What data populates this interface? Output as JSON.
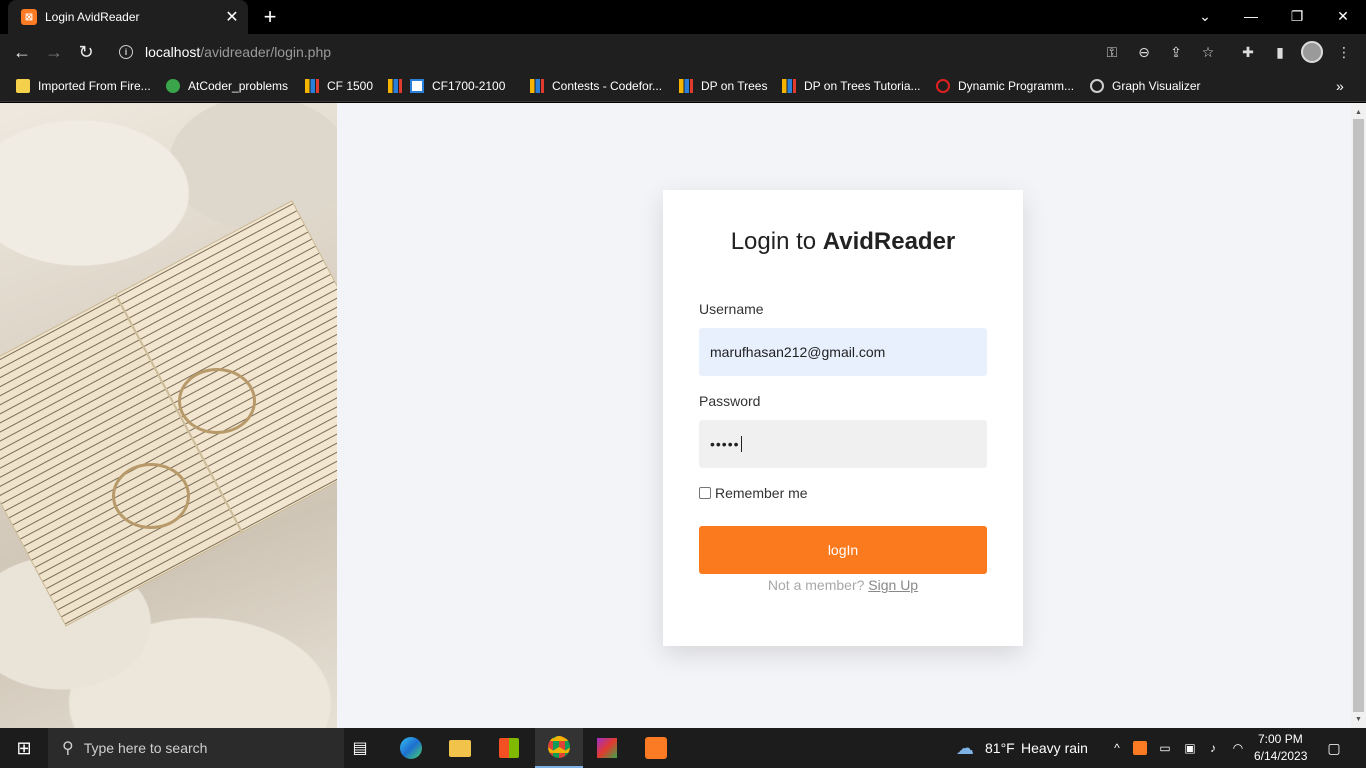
{
  "browser": {
    "tab_title": "Login AvidReader",
    "tab_favicon": "xampp-icon",
    "url_host": "localhost",
    "url_path": "/avidreader/login.php"
  },
  "bookmarks": [
    {
      "label": "Imported From Fire...",
      "icon": "folder-icon"
    },
    {
      "label": "AtCoder_problems",
      "icon": "atcoder-icon"
    },
    {
      "label": "CF 1500",
      "icon": "codeforces-icon"
    },
    {
      "label": "CF1700-2100",
      "icon": "cf-icon"
    },
    {
      "label": "Contests - Codefor...",
      "icon": "codeforces-icon"
    },
    {
      "label": "DP on Trees",
      "icon": "codeforces-icon"
    },
    {
      "label": "DP on Trees Tutoria...",
      "icon": "codeforces-icon"
    },
    {
      "label": "Dynamic Programm...",
      "icon": "quora-icon"
    },
    {
      "label": "Graph Visualizer",
      "icon": "globe-icon"
    }
  ],
  "login": {
    "title_prefix": "Login to ",
    "title_brand": "AvidReader",
    "username_label": "Username",
    "username_value": "marufhasan212@gmail.com",
    "password_label": "Password",
    "password_value": "•••••",
    "remember_label": "Remember me",
    "button_label": "logIn",
    "member_text": "Not a member? ",
    "signup_label": "Sign Up"
  },
  "taskbar": {
    "search_placeholder": "Type here to search",
    "weather_temp": "81°F",
    "weather_desc": "Heavy rain",
    "time": "7:00 PM",
    "date": "6/14/2023"
  },
  "colors": {
    "accent": "#fb7a1e",
    "username_bg": "#e8f0fe"
  }
}
